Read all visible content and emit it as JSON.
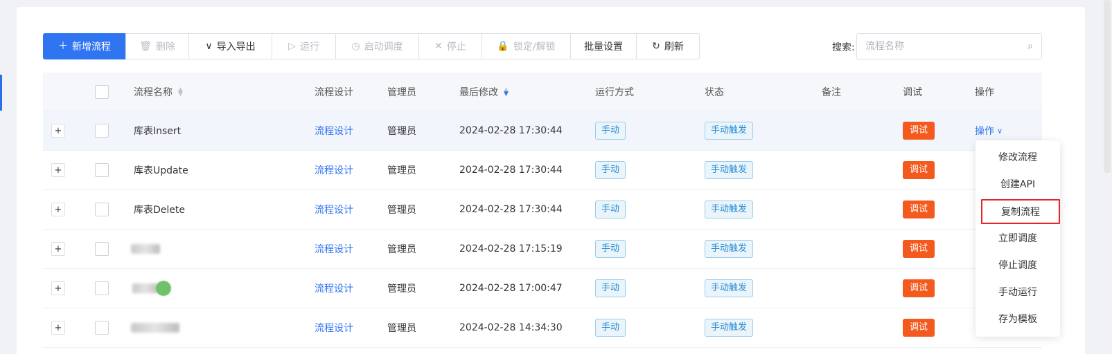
{
  "toolbar": {
    "add": {
      "label": "新增流程",
      "icon": "plus-icon"
    },
    "delete": {
      "label": "删除",
      "icon": "trash-icon"
    },
    "import_export": {
      "label": "导入导出",
      "icon": "chevron-down-icon"
    },
    "run": {
      "label": "运行",
      "icon": "play-icon"
    },
    "start_schedule": {
      "label": "启动调度",
      "icon": "clock-icon"
    },
    "stop": {
      "label": "停止",
      "icon": "close-icon"
    },
    "lock_unlock": {
      "label": "锁定/解锁",
      "icon": "lock-icon"
    },
    "batch_settings": {
      "label": "批量设置"
    },
    "refresh": {
      "label": "刷新",
      "icon": "refresh-icon"
    }
  },
  "search": {
    "label": "搜索:",
    "placeholder": "流程名称",
    "icon": "search-icon"
  },
  "table": {
    "columns": {
      "name": "流程名称",
      "design": "流程设计",
      "admin": "管理员",
      "modified": "最后修改",
      "run_mode": "运行方式",
      "status": "状态",
      "remark": "备注",
      "debug": "调试",
      "ops": "操作"
    },
    "rows": [
      {
        "name": "库表Insert",
        "design": "流程设计",
        "admin": "管理员",
        "modified": "2024-02-28 17:30:44",
        "run_mode": "手动",
        "status": "手动触发",
        "remark": "",
        "debug": "调试",
        "ops": "操作",
        "expand": "+"
      },
      {
        "name": "库表Update",
        "design": "流程设计",
        "admin": "管理员",
        "modified": "2024-02-28 17:30:44",
        "run_mode": "手动",
        "status": "手动触发",
        "remark": "",
        "debug": "调试",
        "expand": "+"
      },
      {
        "name": "库表Delete",
        "design": "流程设计",
        "admin": "管理员",
        "modified": "2024-02-28 17:30:44",
        "run_mode": "手动",
        "status": "手动触发",
        "remark": "",
        "debug": "调试",
        "expand": "+"
      },
      {
        "name": "",
        "design": "流程设计",
        "admin": "管理员",
        "modified": "2024-02-28 17:15:19",
        "run_mode": "手动",
        "status": "手动触发",
        "remark": "",
        "debug": "调试",
        "expand": "+"
      },
      {
        "name": "",
        "design": "流程设计",
        "admin": "管理员",
        "modified": "2024-02-28 17:00:47",
        "run_mode": "手动",
        "status": "手动触发",
        "remark": "",
        "debug": "调试",
        "expand": "+"
      },
      {
        "name": "",
        "design": "流程设计",
        "admin": "管理员",
        "modified": "2024-02-28 14:34:30",
        "run_mode": "手动",
        "status": "手动触发",
        "remark": "",
        "debug": "调试",
        "expand": "+"
      }
    ]
  },
  "dropdown": {
    "items": [
      "修改流程",
      "创建API",
      "复制流程",
      "立即调度",
      "停止调度",
      "手动运行",
      "存为模板"
    ],
    "selected_item": "复制流程"
  },
  "colors": {
    "primary": "#2f74f1",
    "debug_tag": "#f45a1e",
    "info_tag_border": "#9ecbe8",
    "highlight_box": "#e4262b"
  }
}
